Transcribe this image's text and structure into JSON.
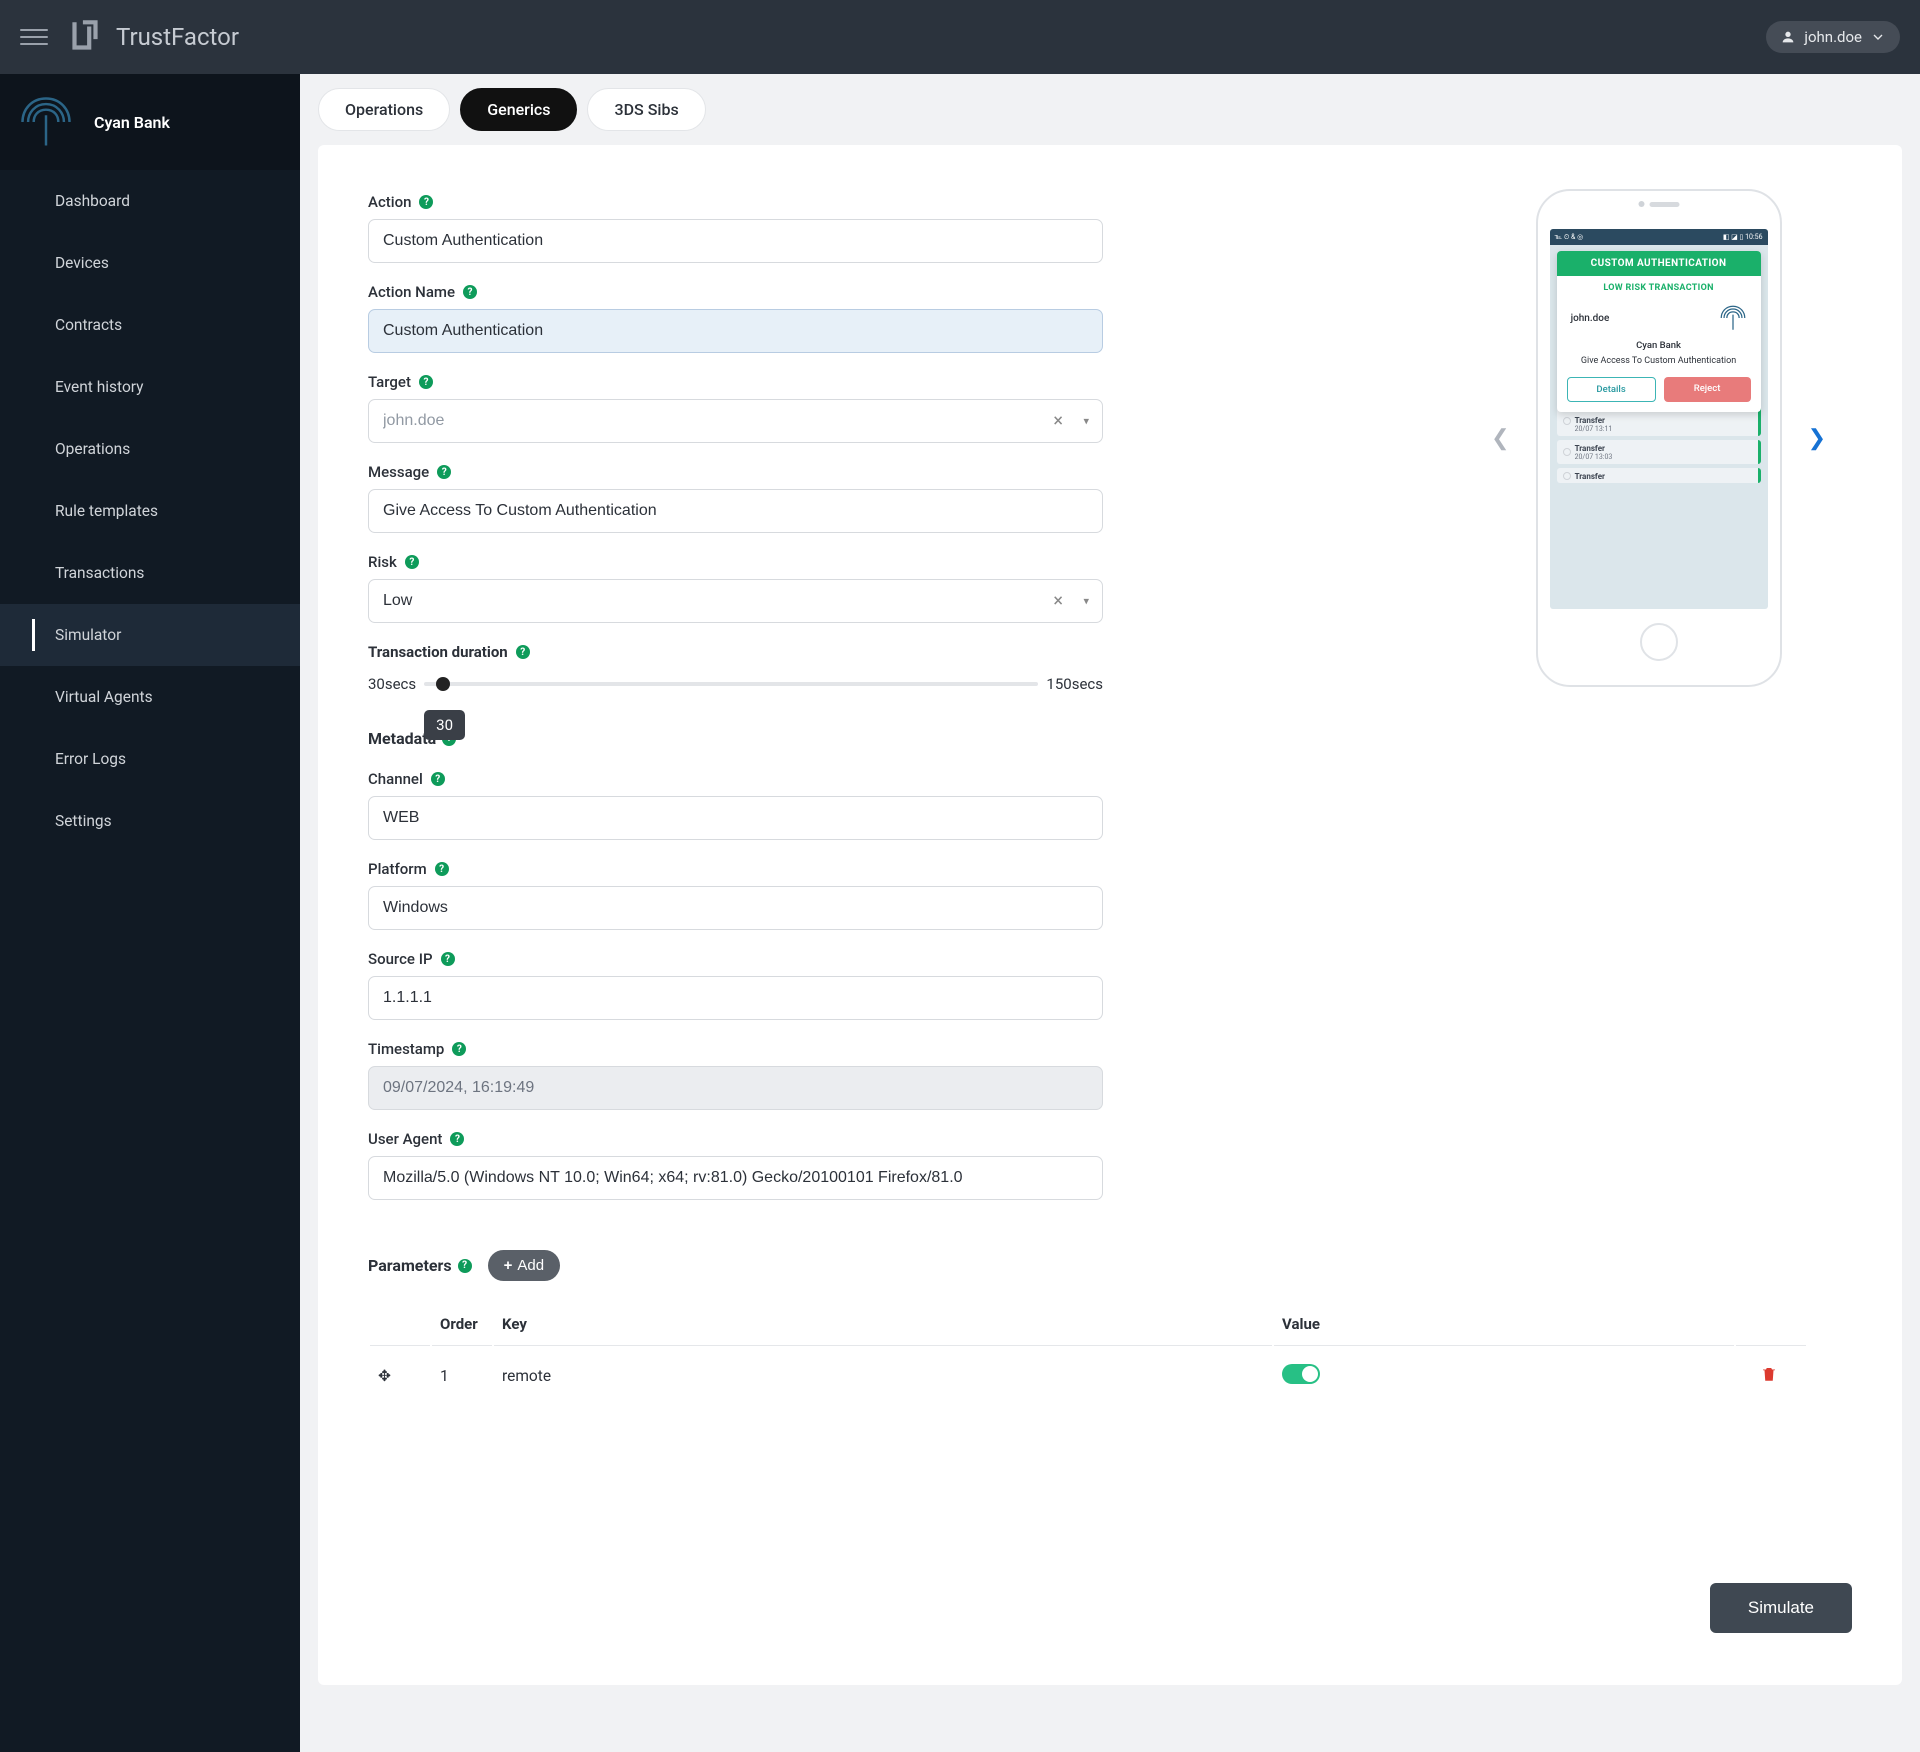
{
  "app": {
    "name": "TrustFactor"
  },
  "user": {
    "name": "john.doe"
  },
  "org": {
    "name": "Cyan Bank"
  },
  "sidebar": {
    "items": [
      {
        "label": "Dashboard"
      },
      {
        "label": "Devices"
      },
      {
        "label": "Contracts"
      },
      {
        "label": "Event history"
      },
      {
        "label": "Operations"
      },
      {
        "label": "Rule templates"
      },
      {
        "label": "Transactions"
      },
      {
        "label": "Simulator"
      },
      {
        "label": "Virtual Agents"
      },
      {
        "label": "Error Logs"
      },
      {
        "label": "Settings"
      }
    ],
    "active_index": 7
  },
  "tabs": [
    {
      "label": "Operations"
    },
    {
      "label": "Generics"
    },
    {
      "label": "3DS Sibs"
    }
  ],
  "active_tab": 1,
  "form": {
    "action": {
      "label": "Action",
      "value": "Custom Authentication"
    },
    "action_name": {
      "label": "Action Name",
      "value": "Custom Authentication"
    },
    "target": {
      "label": "Target",
      "value": "john.doe"
    },
    "message": {
      "label": "Message",
      "value": "Give Access To Custom Authentication"
    },
    "risk": {
      "label": "Risk",
      "value": "Low"
    },
    "duration": {
      "label": "Transaction duration",
      "min_label": "30secs",
      "max_label": "150secs",
      "value": "30"
    },
    "metadata_label": "Metadata",
    "channel": {
      "label": "Channel",
      "value": "WEB"
    },
    "platform": {
      "label": "Platform",
      "value": "Windows"
    },
    "source_ip": {
      "label": "Source IP",
      "value": "1.1.1.1"
    },
    "timestamp": {
      "label": "Timestamp",
      "value": "09/07/2024, 16:19:49"
    },
    "user_agent": {
      "label": "User Agent",
      "value": "Mozilla/5.0 (Windows NT 10.0; Win64; x64; rv:81.0) Gecko/20100101 Firefox/81.0"
    }
  },
  "parameters": {
    "label": "Parameters",
    "add_label": "Add",
    "columns": {
      "order": "Order",
      "key": "Key",
      "value": "Value"
    },
    "rows": [
      {
        "order": "1",
        "key": "remote",
        "value_on": true
      }
    ]
  },
  "simulate_label": "Simulate",
  "preview": {
    "header": "CUSTOM AUTHENTICATION",
    "risk": "LOW RISK TRANSACTION",
    "user": "john.doe",
    "bank": "Cyan Bank",
    "message": "Give Access To Custom Authentication",
    "details": "Details",
    "reject": "Reject",
    "bg_rows": [
      {
        "t1": "Transfer",
        "t2": "20/07 13:11"
      },
      {
        "t1": "Transfer",
        "t2": "20/07 13:03"
      },
      {
        "t1": "Transfer",
        "t2": ""
      }
    ],
    "status_left": "℡ ⏲ & ◎",
    "status_right": "◧ ◪ ▯ 10:56"
  }
}
